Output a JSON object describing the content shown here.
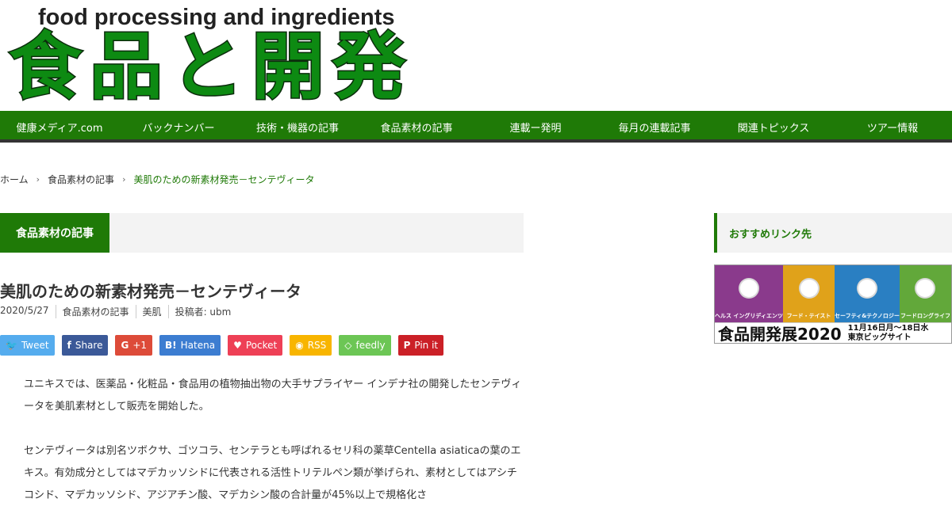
{
  "logo": {
    "tagline": "food processing and ingredients",
    "kanji": [
      "食",
      "品",
      "と",
      "開",
      "発"
    ]
  },
  "nav": [
    {
      "label": "健康メディア.com"
    },
    {
      "label": "バックナンバー"
    },
    {
      "label": "技術・機器の記事"
    },
    {
      "label": "食品素材の記事"
    },
    {
      "label": "連載ー発明"
    },
    {
      "label": "毎月の連載記事"
    },
    {
      "label": "関連トピックス"
    },
    {
      "label": "ツアー情報"
    }
  ],
  "breadcrumb": {
    "home": "ホーム",
    "category": "食品素材の記事",
    "current": "美肌のための新素材発売－センテヴィータ"
  },
  "category_label": "食品素材の記事",
  "article": {
    "title": "美肌のための新素材発売－センテヴィータ",
    "date": "2020/5/27",
    "category": "食品素材の記事",
    "tag": "美肌",
    "author": "投稿者: ubm",
    "paragraphs": [
      "ユニキスでは、医薬品・化粧品・食品用の植物抽出物の大手サプライヤー インデナ社の開発したセンテヴィータを美肌素材として販売を開始した。",
      "センテヴィータは別名ツボクサ、ゴツコラ、センテラとも呼ばれるセリ科の薬草Centella asiaticaの葉のエキス。有効成分としてはマデカッソシドに代表される活性トリテルペン類が挙げられ、素材としてはアシチコシド、マデカッソシド、アジアチン酸、マデカシン酸の合計量が45%以上で規格化さ"
    ]
  },
  "share": [
    {
      "icon": "twitter-icon",
      "glyph": "🐦",
      "label": "Tweet",
      "color": "#55acee"
    },
    {
      "icon": "facebook-icon",
      "glyph": "f",
      "label": "Share",
      "color": "#3b5998"
    },
    {
      "icon": "google-plus-icon",
      "glyph": "G",
      "label": "+1",
      "color": "#dd4b39"
    },
    {
      "icon": "hatena-icon",
      "glyph": "B!",
      "label": "Hatena",
      "color": "#3c7dd1"
    },
    {
      "icon": "pocket-icon",
      "glyph": "♥",
      "label": "Pocket",
      "color": "#ee4056"
    },
    {
      "icon": "rss-icon",
      "glyph": "◉",
      "label": "RSS",
      "color": "#f8b500"
    },
    {
      "icon": "feedly-icon",
      "glyph": "◇",
      "label": "feedly",
      "color": "#6cc655"
    },
    {
      "icon": "pinterest-icon",
      "glyph": "P",
      "label": "Pin it",
      "color": "#cb2027"
    }
  ],
  "sidebar": {
    "heading": "おすすめリンク先",
    "banner": {
      "tiles": [
        {
          "name": "ヘルス イングリディエンツ",
          "color": "#8a3a8c"
        },
        {
          "name": "フード・テイスト",
          "color": "#e0a21a"
        },
        {
          "name": "セーフティ&テクノロジー",
          "color": "#2a7fc2"
        },
        {
          "name": "フードロングライフ",
          "color": "#62a83a"
        }
      ],
      "title": "食品開発展2020",
      "dates": "11月16日月～18日水",
      "venue": "東京ビッグサイト"
    }
  },
  "colors": {
    "brand_green": "#1f7a07",
    "nav_border": "#333333",
    "band_bg": "#f3f3f3"
  }
}
